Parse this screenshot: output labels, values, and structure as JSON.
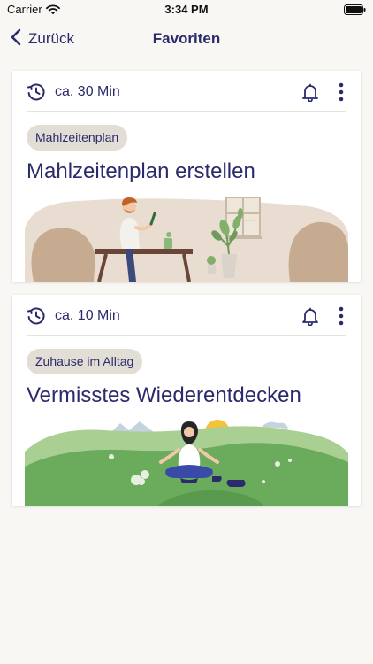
{
  "status_bar": {
    "carrier": "Carrier",
    "time": "3:34 PM"
  },
  "nav": {
    "back_label": "Zurück",
    "title": "Favoriten"
  },
  "cards": [
    {
      "duration": "ca. 30 Min",
      "tag": "Mahlzeitenplan",
      "title": "Mahlzeitenplan erstellen"
    },
    {
      "duration": "ca. 10 Min",
      "tag": "Zuhause im Alltag",
      "title": "Vermisstes Wiederentdecken"
    }
  ],
  "colors": {
    "primary": "#2b2a6b",
    "background": "#f8f7f3",
    "tag_bg": "#e2ded5",
    "card_bg": "#ffffff"
  }
}
